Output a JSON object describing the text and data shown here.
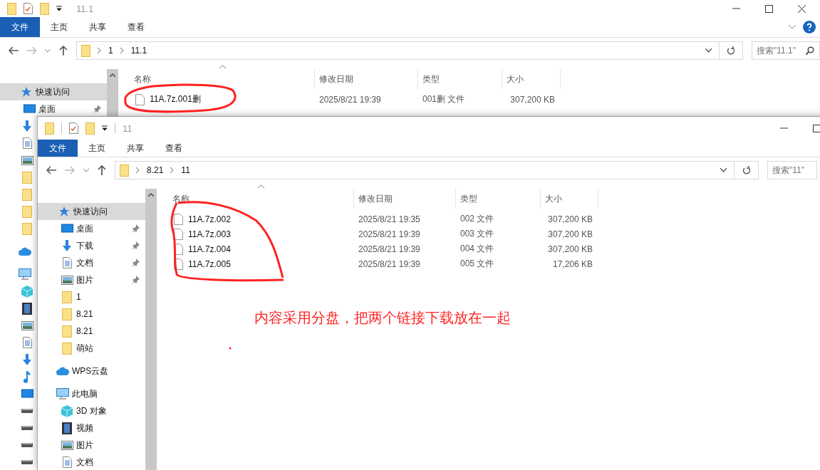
{
  "windows": [
    {
      "title": "11.1",
      "ribbon_tabs": [
        {
          "label": "文件",
          "selected": true
        },
        {
          "label": "主页",
          "selected": false
        },
        {
          "label": "共享",
          "selected": false
        },
        {
          "label": "查看",
          "selected": false
        }
      ],
      "breadcrumb": [
        "1",
        "11.1"
      ],
      "search": {
        "placeholder": "搜索\"11.1\""
      },
      "sidebar": [
        {
          "kind": "star",
          "label": "快速访问",
          "selected": true,
          "pinned": false
        },
        {
          "kind": "desktop",
          "label": "桌面",
          "selected": false,
          "pinned": true
        },
        {
          "kind": "download",
          "selected": false
        },
        {
          "kind": "doc",
          "selected": false
        },
        {
          "kind": "picture",
          "selected": false
        },
        {
          "kind": "folder",
          "selected": false
        },
        {
          "kind": "folder",
          "selected": false
        },
        {
          "kind": "folder",
          "selected": false
        },
        {
          "kind": "folder",
          "selected": false
        },
        {
          "kind": "cloud",
          "selected": false
        },
        {
          "kind": "pc",
          "selected": false
        },
        {
          "kind": "cube",
          "selected": false
        },
        {
          "kind": "video",
          "selected": false
        },
        {
          "kind": "picture",
          "selected": false
        },
        {
          "kind": "doc",
          "selected": false
        },
        {
          "kind": "download",
          "selected": false
        },
        {
          "kind": "music",
          "selected": false
        },
        {
          "kind": "desktop",
          "selected": false
        },
        {
          "kind": "drive",
          "selected": false
        },
        {
          "kind": "drive",
          "selected": false
        },
        {
          "kind": "drive",
          "selected": false
        },
        {
          "kind": "drive",
          "selected": false
        }
      ],
      "columns": [
        "名称",
        "修改日期",
        "类型",
        "大小"
      ],
      "files": [
        {
          "name": "11A.7z.001删",
          "modified": "2025/8/21 19:39",
          "type": "001删 文件",
          "size": "307,200 KB"
        }
      ]
    },
    {
      "title": "11",
      "ribbon_tabs": [
        {
          "label": "文件",
          "selected": true
        },
        {
          "label": "主页",
          "selected": false
        },
        {
          "label": "共享",
          "selected": false
        },
        {
          "label": "查看",
          "selected": false
        }
      ],
      "breadcrumb": [
        "8.21",
        "11"
      ],
      "search": {
        "placeholder": "搜索\"11\""
      },
      "sidebar": [
        {
          "kind": "star",
          "label": "快速访问",
          "selected": true,
          "pinned": false
        },
        {
          "kind": "desktop",
          "label": "桌面",
          "selected": false,
          "pinned": true
        },
        {
          "kind": "download",
          "label": "下载",
          "selected": false,
          "pinned": true
        },
        {
          "kind": "doc",
          "label": "文档",
          "selected": false,
          "pinned": true
        },
        {
          "kind": "picture",
          "label": "图片",
          "selected": false,
          "pinned": true
        },
        {
          "kind": "folder",
          "label": "1",
          "selected": false,
          "pinned": false
        },
        {
          "kind": "folder",
          "label": "8.21",
          "selected": false,
          "pinned": false
        },
        {
          "kind": "folder",
          "label": "8.21",
          "selected": false,
          "pinned": false
        },
        {
          "kind": "folder",
          "label": "萌站",
          "selected": false,
          "pinned": false
        },
        {
          "kind": "cloud",
          "label": "WPS云盘",
          "selected": false,
          "pinned": false
        },
        {
          "kind": "pc",
          "label": "此电脑",
          "selected": false,
          "pinned": false
        },
        {
          "kind": "cube",
          "label": "3D 对象",
          "selected": false,
          "pinned": false
        },
        {
          "kind": "video",
          "label": "视频",
          "selected": false,
          "pinned": false
        },
        {
          "kind": "picture",
          "label": "图片",
          "selected": false,
          "pinned": false
        },
        {
          "kind": "doc",
          "label": "文档",
          "selected": false,
          "pinned": false
        }
      ],
      "columns": [
        "名称",
        "修改日期",
        "类型",
        "大小"
      ],
      "files": [
        {
          "name": "11A.7z.002",
          "modified": "2025/8/21 19:35",
          "type": "002 文件",
          "size": "307,200 KB"
        },
        {
          "name": "11A.7z.003",
          "modified": "2025/8/21 19:39",
          "type": "003 文件",
          "size": "307,200 KB"
        },
        {
          "name": "11A.7z.004",
          "modified": "2025/8/21 19:39",
          "type": "004 文件",
          "size": "307,200 KB"
        },
        {
          "name": "11A.7z.005",
          "modified": "2025/8/21 19:39",
          "type": "005 文件",
          "size": "17,206 KB"
        }
      ]
    }
  ],
  "annotation": {
    "text": "内容采用分盘，把两个链接下载放在一起"
  }
}
